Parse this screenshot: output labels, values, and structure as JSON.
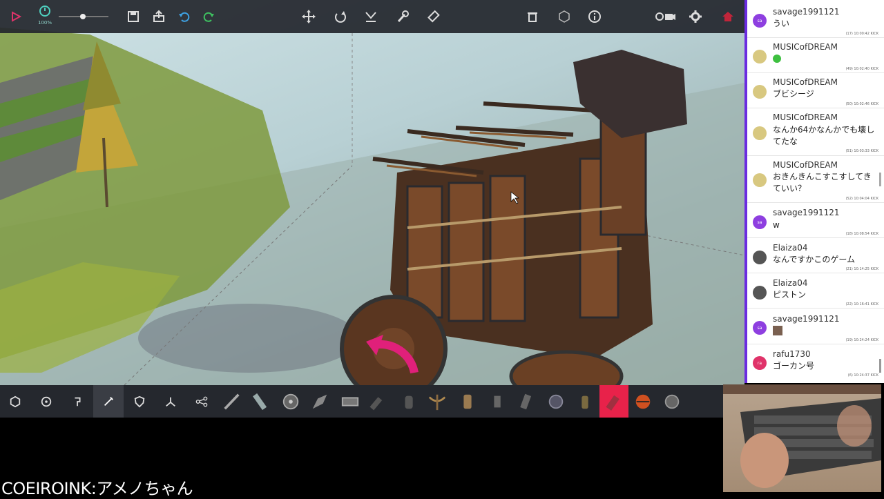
{
  "top_toolbar": {
    "zoom_label": "100%",
    "icons": [
      "play-icon",
      "time-scale-icon",
      "save-icon",
      "load-icon",
      "undo-icon",
      "redo-icon",
      "move-icon",
      "rotate-icon",
      "mirror-icon",
      "wrench-icon",
      "eraser-icon",
      "delete-icon",
      "center-icon",
      "info-icon",
      "camera-icon",
      "settings-icon",
      "home-icon"
    ]
  },
  "bottom_toolbar": {
    "categories": [
      "basic-blocks",
      "mechanical",
      "locomotion",
      "modifiers",
      "armour",
      "physics",
      "automation"
    ],
    "search_icon": "search-icon",
    "selected_color": "#e8224a"
  },
  "chat": {
    "accent": "#6a2be0",
    "messages": [
      {
        "user": "savage1991121",
        "avatar": "sa",
        "avatar_color": "#8e3fe0",
        "text": "うい",
        "meta": "(17) 10:00:42  KICK"
      },
      {
        "user": "MUSICofDREAM",
        "avatar": "",
        "avatar_color": "#d8c880",
        "text": "",
        "meta": "(49) 10:02:40  KICK"
      },
      {
        "user": "MUSICofDREAM",
        "avatar": "",
        "avatar_color": "#d8c880",
        "text": "ブビシージ",
        "meta": "(50) 10:02:46  KICK"
      },
      {
        "user": "MUSICofDREAM",
        "avatar": "",
        "avatar_color": "#d8c880",
        "text": "なんか64かなんかでも壊してたな",
        "meta": "(51) 10:03:33  KICK"
      },
      {
        "user": "MUSICofDREAM",
        "avatar": "",
        "avatar_color": "#d8c880",
        "text": "おきんきんこすこすしてきていい？",
        "meta": "(52) 10:04:04  KICK"
      },
      {
        "user": "savage1991121",
        "avatar": "sa",
        "avatar_color": "#8e3fe0",
        "text": "w",
        "meta": "(18) 10:08:54  KICK"
      },
      {
        "user": "Elaiza04",
        "avatar": "",
        "avatar_color": "#555555",
        "text": "なんですかこのゲーム",
        "meta": "(21) 10:14:25  KICK"
      },
      {
        "user": "Elaiza04",
        "avatar": "",
        "avatar_color": "#555555",
        "text": "ピストン",
        "meta": "(22) 10:16:41  KICK"
      },
      {
        "user": "savage1991121",
        "avatar": "sa",
        "avatar_color": "#8e3fe0",
        "text": "",
        "meta": "(19) 10:24:24  KICK"
      },
      {
        "user": "rafu1730",
        "avatar": "ra",
        "avatar_color": "#e0336a",
        "text": "ゴーカン号",
        "meta": "(6) 10:24:37  KICK"
      }
    ]
  },
  "caption": "COEIROINK:アメノちゃん"
}
